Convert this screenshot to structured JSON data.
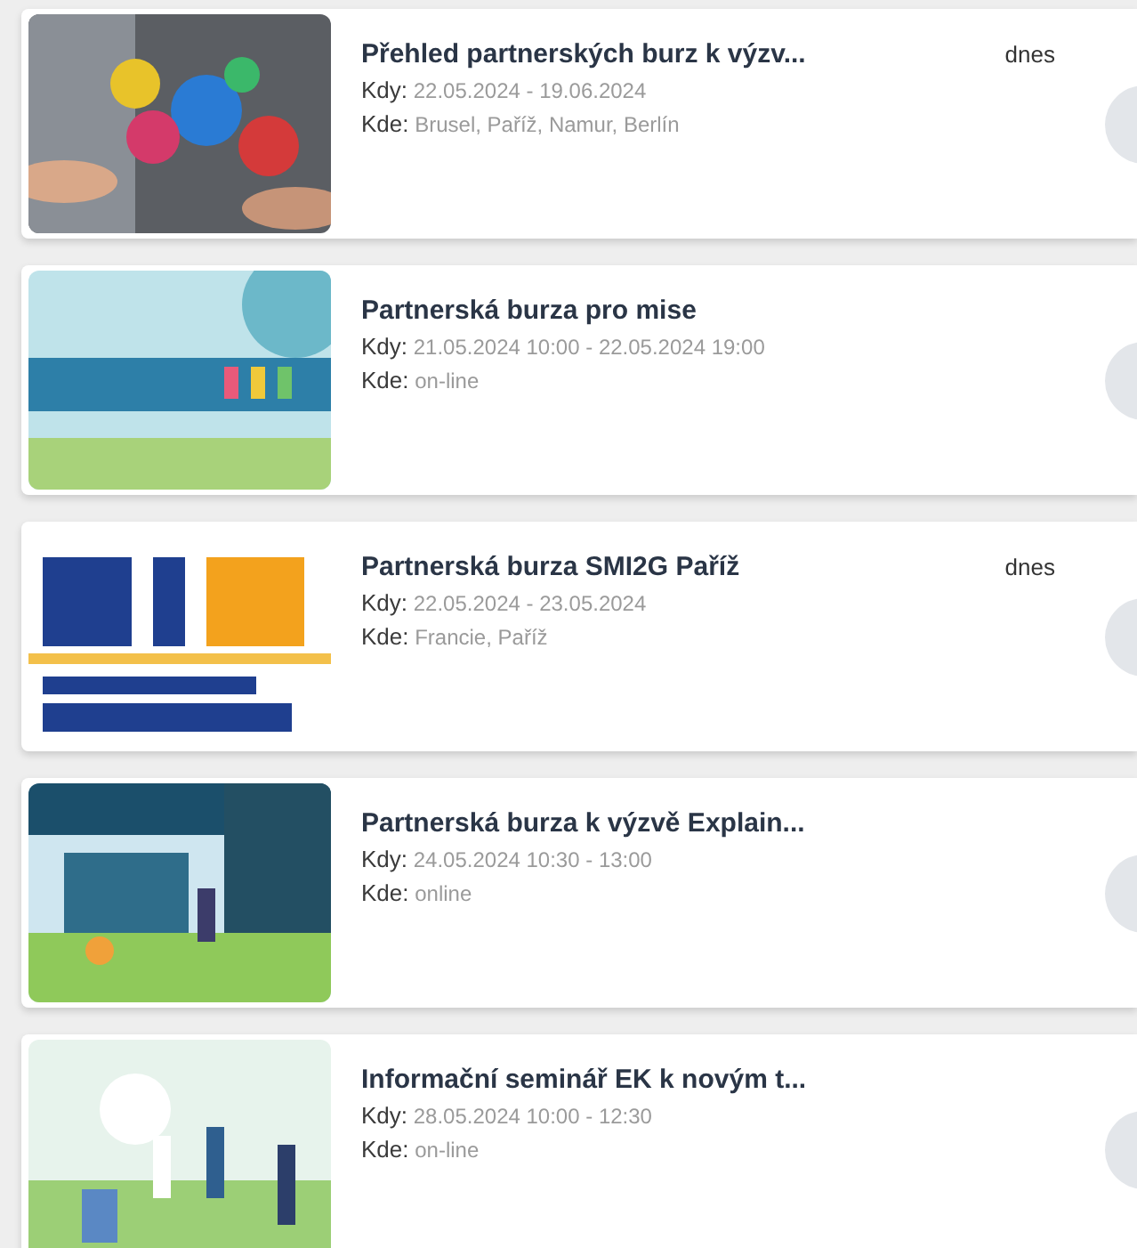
{
  "events": [
    {
      "title": "Přehled partnerských burz k výzv...",
      "badge": "dnes",
      "when_label": "Kdy:",
      "when": "22.05.2024 - 19.06.2024",
      "where_label": "Kde:",
      "where": "Brusel, Paříž, Namur, Berlín"
    },
    {
      "title": "Partnerská burza pro mise",
      "when_label": "Kdy:",
      "when": "21.05.2024 10:00 - 22.05.2024 19:00",
      "where_label": "Kde:",
      "where": "on-line"
    },
    {
      "title": "Partnerská burza SMI2G Paříž",
      "badge": "dnes",
      "when_label": "Kdy:",
      "when": "22.05.2024 - 23.05.2024",
      "where_label": "Kde:",
      "where": "Francie, Paříž"
    },
    {
      "title": "Partnerská burza k výzvě Explain...",
      "when_label": "Kdy:",
      "when": "24.05.2024 10:30 - 13:00",
      "where_label": "Kde:",
      "where": "online"
    },
    {
      "title": "Informační seminář EK k novým t...",
      "when_label": "Kdy:",
      "when": "28.05.2024 10:00 - 12:30",
      "where_label": "Kde:",
      "where": "on-line"
    }
  ]
}
